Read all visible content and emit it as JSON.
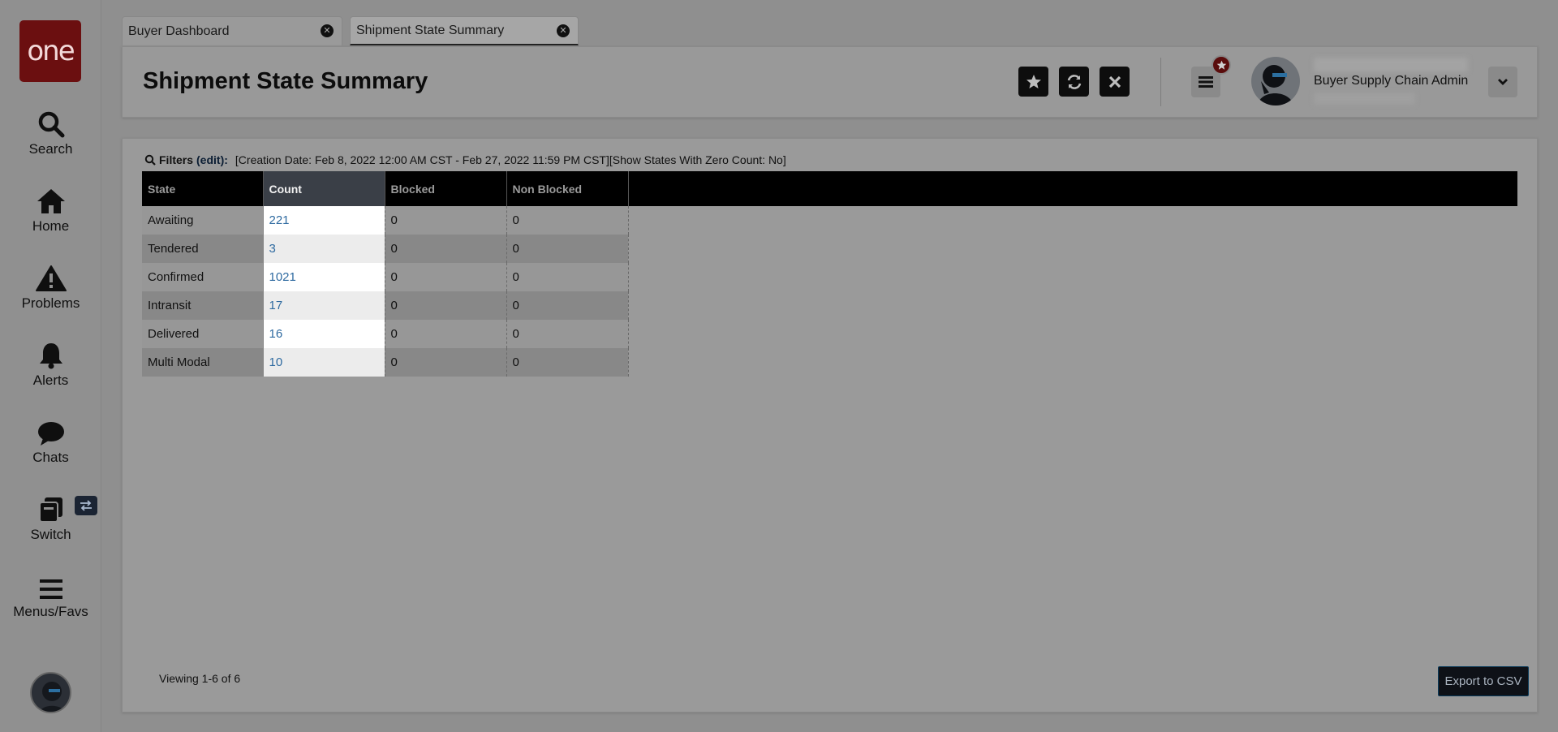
{
  "sidebar": {
    "logo_text": "one",
    "items": [
      {
        "label": "Search",
        "icon": "search-icon"
      },
      {
        "label": "Home",
        "icon": "home-icon"
      },
      {
        "label": "Problems",
        "icon": "warning-icon"
      },
      {
        "label": "Alerts",
        "icon": "bell-icon"
      },
      {
        "label": "Chats",
        "icon": "chat-bubble-icon"
      },
      {
        "label": "Switch",
        "icon": "switch-icon"
      },
      {
        "label": "Menus/Favs",
        "icon": "hamburger-icon"
      }
    ]
  },
  "tabs": [
    {
      "label": "Buyer Dashboard",
      "active": false
    },
    {
      "label": "Shipment State Summary",
      "active": true
    }
  ],
  "header": {
    "title": "Shipment State Summary",
    "user_role": "Buyer Supply Chain Admin",
    "buttons": [
      "star-icon",
      "refresh-icon",
      "close-icon"
    ]
  },
  "filters": {
    "label": "Filters",
    "edit_label": "(edit)",
    "colon": ":",
    "text": "[Creation Date: Feb 8, 2022 12:00 AM CST - Feb 27, 2022 11:59 PM CST][Show States With Zero Count: No]"
  },
  "table": {
    "columns": [
      "State",
      "Count",
      "Blocked",
      "Non Blocked"
    ],
    "rows": [
      {
        "state": "Awaiting",
        "count": "221",
        "blocked": "0",
        "non_blocked": "0"
      },
      {
        "state": "Tendered",
        "count": "3",
        "blocked": "0",
        "non_blocked": "0"
      },
      {
        "state": "Confirmed",
        "count": "1021",
        "blocked": "0",
        "non_blocked": "0"
      },
      {
        "state": "Intransit",
        "count": "17",
        "blocked": "0",
        "non_blocked": "0"
      },
      {
        "state": "Delivered",
        "count": "16",
        "blocked": "0",
        "non_blocked": "0"
      },
      {
        "state": "Multi Modal",
        "count": "10",
        "blocked": "0",
        "non_blocked": "0"
      }
    ]
  },
  "footer": {
    "viewing": "Viewing 1-6 of 6",
    "export_label": "Export to CSV"
  },
  "colors": {
    "logo_bg": "#6b0f10",
    "link": "#2e6aa0",
    "header_bg": "#000000"
  }
}
